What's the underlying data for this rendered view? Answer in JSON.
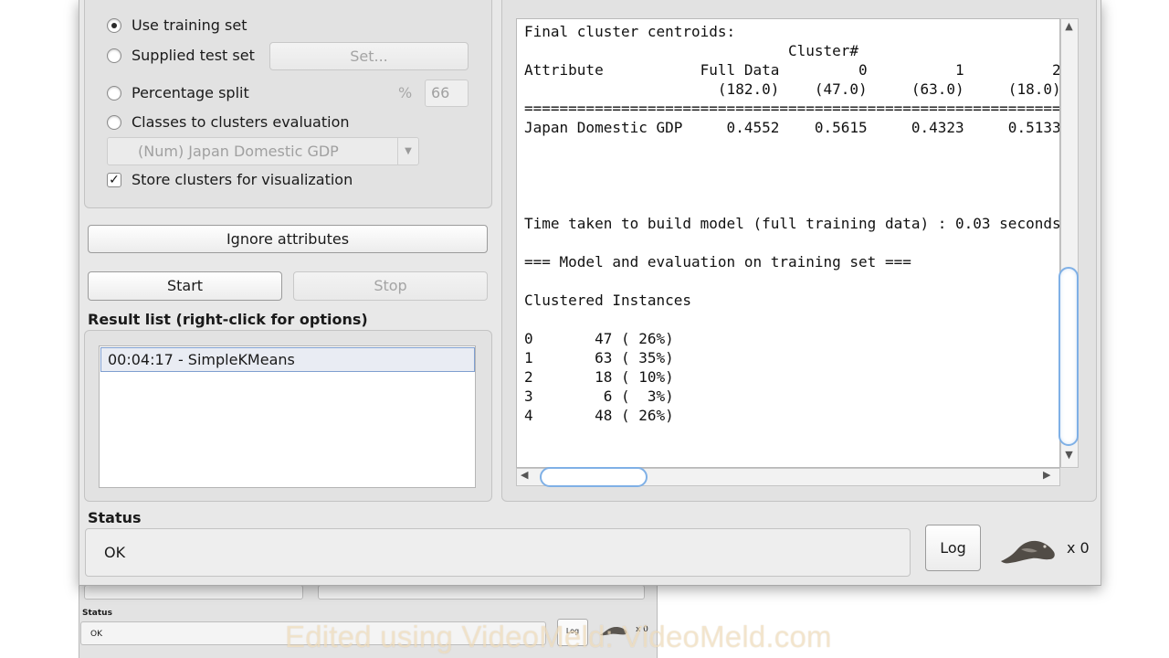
{
  "cluster_mode": {
    "use_training_set": "Use training set",
    "supplied_test_set": "Supplied test set",
    "set_button": "Set...",
    "percentage_split": "Percentage split",
    "percent_symbol": "%",
    "percent_value": "66",
    "classes_to_clusters": "Classes to clusters evaluation",
    "class_attribute_selected": "(Num) Japan Domestic GDP",
    "store_clusters": "Store clusters for visualization",
    "selected_mode": "Use training set",
    "store_clusters_checked": true
  },
  "buttons": {
    "ignore_attributes": "Ignore attributes",
    "start": "Start",
    "stop": "Stop"
  },
  "result_list": {
    "title": "Result list (right-click for options)",
    "items": [
      "00:04:17 - SimpleKMeans"
    ]
  },
  "output": {
    "lines": [
      "Final cluster centroids:",
      "                              Cluster#",
      "Attribute           Full Data         0          1          2",
      "                      (182.0)    (47.0)     (63.0)     (18.0)",
      "=================================================================",
      "Japan Domestic GDP     0.4552    0.5615     0.4323     0.5133",
      "",
      "",
      "",
      "",
      "Time taken to build model (full training data) : 0.03 seconds",
      "",
      "=== Model and evaluation on training set ===",
      "",
      "Clustered Instances",
      "",
      "0       47 ( 26%)",
      "1       63 ( 35%)",
      "2       18 ( 10%)",
      "3        6 (  3%)",
      "4       48 ( 26%)"
    ]
  },
  "status": {
    "label": "Status",
    "message": "OK",
    "log_button": "Log",
    "bird_icon": "weka-bird-icon",
    "count": "x 0"
  },
  "background_window": {
    "status_label": "Status",
    "status_message": "OK",
    "log_button": "Log",
    "count": "x 0"
  },
  "watermark": "Edited using VideoMeld: VideoMeld.com"
}
